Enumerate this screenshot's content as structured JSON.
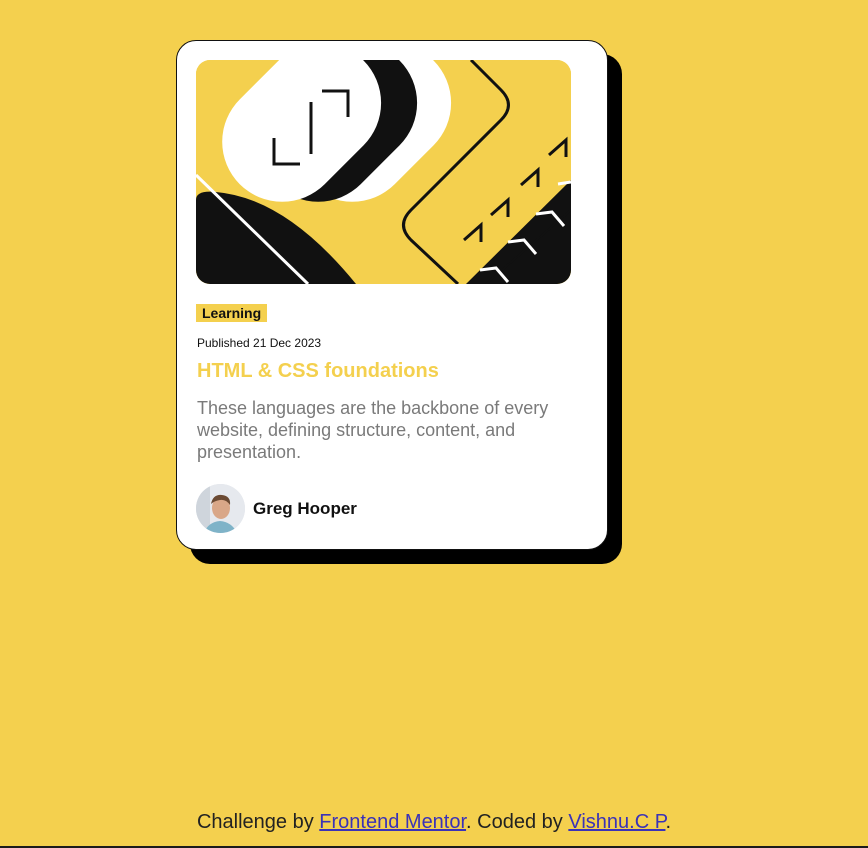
{
  "card": {
    "tag": "Learning",
    "published": "Published 21 Dec 2023",
    "title": "HTML & CSS foundations",
    "description": "These languages are the backbone of every website, defining structure, content, and presentation.",
    "author": "Greg Hooper"
  },
  "footer": {
    "prefix": "Challenge by ",
    "link1": "Frontend Mentor",
    "middle": ". Coded by ",
    "link2": "Vishnu.C P",
    "suffix": "."
  },
  "colors": {
    "background": "#f4d04e",
    "card": "#ffffff",
    "shadow": "#000000",
    "title": "#f4d04e",
    "description": "#7a7a7a",
    "link": "#3a32b8"
  },
  "icons": {
    "hero": "abstract-illustration",
    "avatar": "author-photo"
  }
}
